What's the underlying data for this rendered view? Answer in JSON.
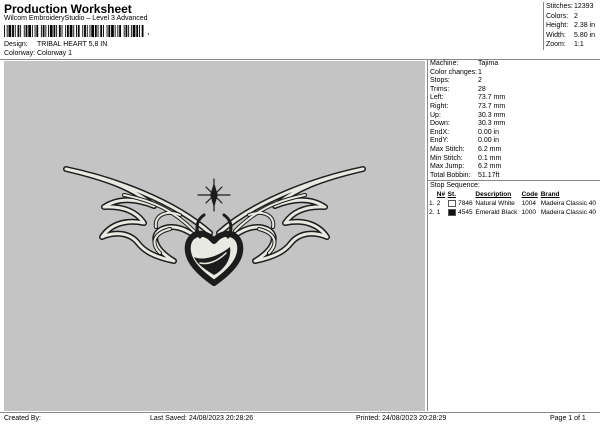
{
  "header": {
    "title": "Production Worksheet",
    "subtitle": "Wilcom EmbroideryStudio – Level 3 Advanced",
    "barcode_mark": ","
  },
  "design": {
    "label": "Design:",
    "value": "TRIBAL HEART 5,8 IN"
  },
  "colorway": {
    "label": "Colorway:",
    "value": "Colorway 1"
  },
  "summary": [
    {
      "k": "Stitches:",
      "v": "12393"
    },
    {
      "k": "Colors:",
      "v": "2"
    },
    {
      "k": "Height:",
      "v": "2.38 in"
    },
    {
      "k": "Width:",
      "v": "5.80 in"
    },
    {
      "k": "Zoom:",
      "v": "1:1"
    }
  ],
  "details": [
    {
      "k": "Machine:",
      "v": "Tajima"
    },
    {
      "k": "Color changes:",
      "v": "1"
    },
    {
      "k": "Stops:",
      "v": "2"
    },
    {
      "k": "Trims:",
      "v": "28"
    },
    {
      "k": "Left:",
      "v": "73.7 mm"
    },
    {
      "k": "Right:",
      "v": "73.7 mm"
    },
    {
      "k": "Up:",
      "v": "30.3 mm"
    },
    {
      "k": "Down:",
      "v": "30.3 mm"
    },
    {
      "k": "EndX:",
      "v": "0.00 in"
    },
    {
      "k": "EndY:",
      "v": "0.00 in"
    },
    {
      "k": "Max Stitch:",
      "v": "6.2 mm"
    },
    {
      "k": "Min Stitch:",
      "v": "0.1 mm"
    },
    {
      "k": "Max Jump:",
      "v": "6.2 mm"
    },
    {
      "k": "Total Bobbin:",
      "v": "51.17ft"
    }
  ],
  "stop_sequence": {
    "label": "Stop Sequence:",
    "headers": [
      "N#",
      "St.",
      "Description",
      "Code",
      "Brand"
    ],
    "rows": [
      {
        "idx": "1.",
        "n": "2",
        "swatch_color": "#ffffff",
        "st": "7846",
        "desc": "Natural White",
        "code": "1004",
        "brand": "Madeira Classic 40"
      },
      {
        "idx": "2.",
        "n": "1",
        "swatch_color": "#111111",
        "st": "4545",
        "desc": "Emerald Black",
        "code": "1000",
        "brand": "Madeira Classic 40"
      }
    ]
  },
  "colors": {
    "canvas_bg": "#c4c4c4",
    "thread_white": "#e9e9e3",
    "thread_black": "#1c1c1c"
  },
  "footer": {
    "created": "Created By:",
    "saved": "Last Saved: 24/08/2023 20:28:26",
    "printed": "Printed: 24/08/2023 20:28:29",
    "page": "Page 1 of 1"
  }
}
